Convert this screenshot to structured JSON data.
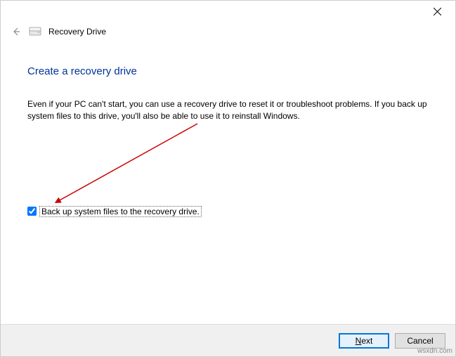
{
  "window": {
    "title": "Recovery Drive"
  },
  "page": {
    "title": "Create a recovery drive",
    "description": "Even if your PC can't start, you can use a recovery drive to reset it or troubleshoot problems. If you back up system files to this drive, you'll also be able to use it to reinstall Windows."
  },
  "checkbox": {
    "label": "Back up system files to the recovery drive.",
    "checked": true
  },
  "buttons": {
    "next": "Next",
    "cancel": "Cancel"
  },
  "watermark": "wsxdn.com"
}
